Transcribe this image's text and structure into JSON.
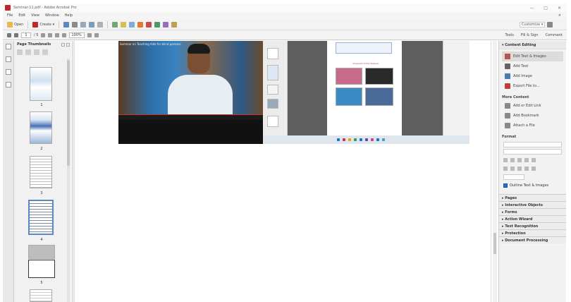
{
  "window": {
    "title": "Seminar-11.pdf - Adobe Acrobat Pro",
    "controls": [
      "—",
      "□",
      "✕"
    ]
  },
  "menu": {
    "items": [
      "File",
      "Edit",
      "View",
      "Window",
      "Help"
    ],
    "close": "×"
  },
  "toolbar": {
    "open_label": "Open",
    "create_label": "Create ▾",
    "customize_label": "Customize ▾"
  },
  "nav": {
    "page_current": "1",
    "page_total": "/ 5",
    "zoom": "100%",
    "right_tabs": [
      "Tools",
      "Fill & Sign",
      "Comment"
    ]
  },
  "thumbnails": {
    "title": "Page Thumbnails",
    "pages": [
      "1",
      "2",
      "3",
      "4",
      "5"
    ]
  },
  "video": {
    "caption": "Seminar on Teaching Aids for blind persons"
  },
  "slide": {
    "label": "Snapshot of the Webinar"
  },
  "right_panel": {
    "content_editing": "▾ Content Editing",
    "edit_items": [
      "Edit Text & Images",
      "Add Text",
      "Add Image",
      "Export File to..."
    ],
    "more_content": "More Content",
    "more_items": [
      "Add or Edit Link",
      "Add Bookmark",
      "Attach a File"
    ],
    "format": "Format",
    "outline_label": "Outline Text & Images",
    "sections": [
      "▸ Pages",
      "▸ Interactive Objects",
      "▸ Forms",
      "▸ Action Wizard",
      "▸ Text Recognition",
      "▸ Protection",
      "▸ Document Processing"
    ]
  },
  "colors": {
    "accent": "#2e6fc4",
    "brand": "#c0262d"
  }
}
